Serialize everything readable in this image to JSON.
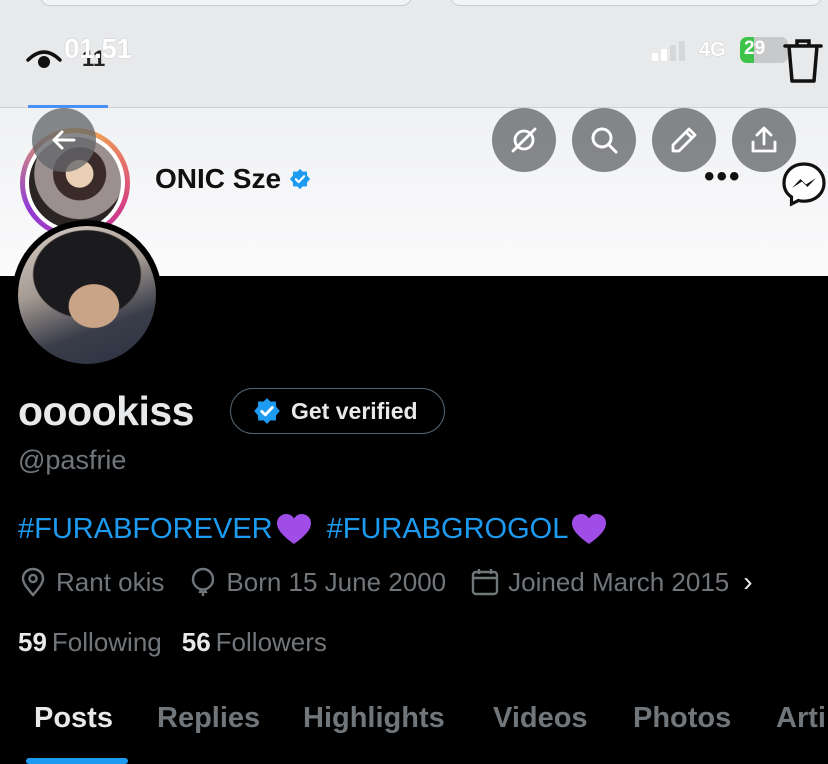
{
  "status_bar": {
    "time": "01.51",
    "ghost_time": "11",
    "network": "4G",
    "battery": "29",
    "battery_fraction": 0.29
  },
  "underlay_profile": {
    "name": "ONIC Sze",
    "more": "•••"
  },
  "profile": {
    "display_name": "ooookiss",
    "get_verified_label": "Get verified",
    "handle": "@pasfrie",
    "bio_tags": [
      "#FURABFOREVER",
      "#FURABGROGOL"
    ],
    "location": "Rant okis",
    "birthday": "Born 15 June 2000",
    "joined": "Joined March 2015",
    "following_count": "59",
    "following_label": "Following",
    "followers_count": "56",
    "followers_label": "Followers"
  },
  "tabs": [
    "Posts",
    "Replies",
    "Highlights",
    "Videos",
    "Photos",
    "Arti"
  ],
  "icons": {
    "back": "back-arrow-icon",
    "grok": "grok-icon",
    "search": "search-icon",
    "edit": "pencil-icon",
    "share": "share-icon",
    "location": "location-pin-icon",
    "birthday": "balloon-icon",
    "calendar": "calendar-icon",
    "verified": "verified-badge-icon",
    "heart": "purple-heart-icon",
    "messenger": "messenger-icon",
    "trash": "trash-icon",
    "eye": "eye-icon"
  },
  "colors": {
    "link": "#1d9bf0",
    "verified": "#1d9bf0",
    "heart": "#a04ce6",
    "muted": "#71767b",
    "text": "#e7e9ea"
  }
}
